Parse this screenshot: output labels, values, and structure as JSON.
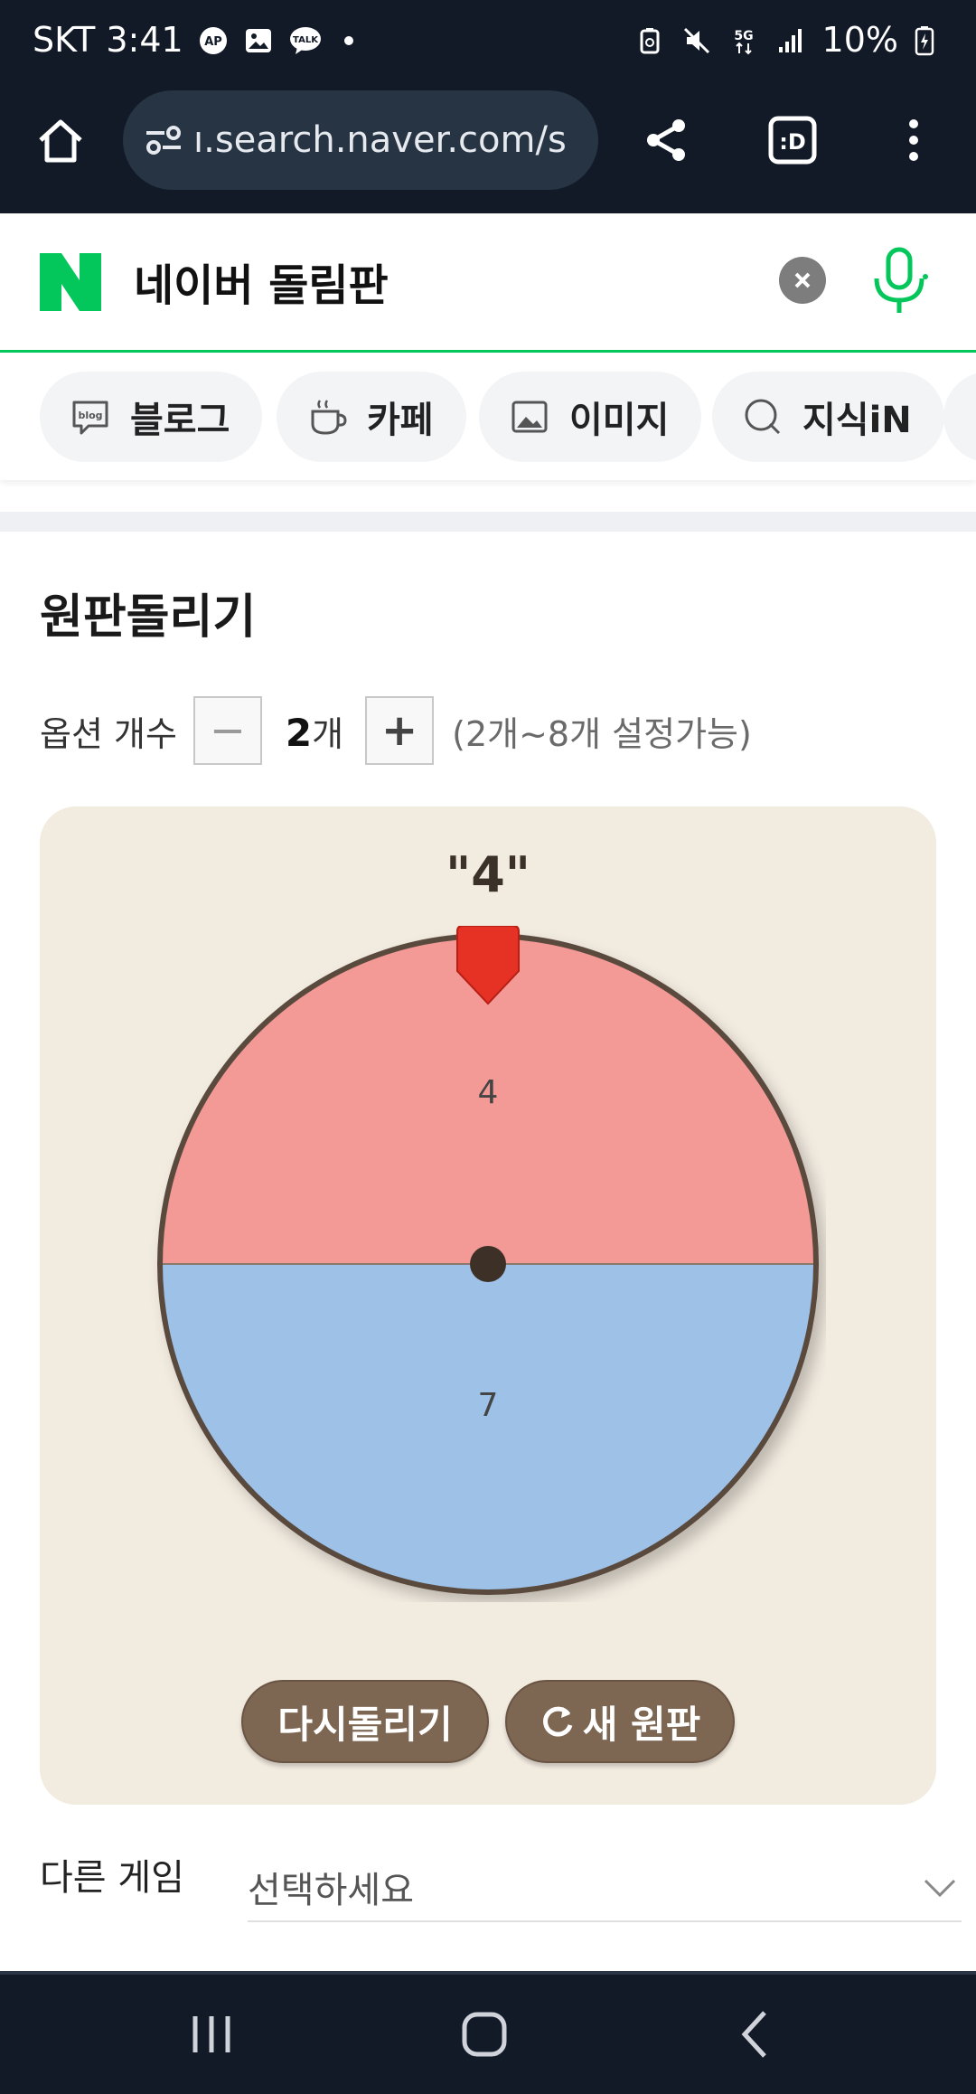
{
  "status_bar": {
    "carrier_time": "SKT 3:41",
    "battery": "10%",
    "network": "5G",
    "notification_icons": [
      "ap-icon",
      "gallery-icon",
      "talk-icon",
      "dot-icon"
    ],
    "system_icons": [
      "recycle-icon",
      "mute-icon",
      "5g-icon",
      "signal-icon",
      "battery-icon"
    ]
  },
  "browser": {
    "url": "ı.search.naver.com/s"
  },
  "search": {
    "query": "네이버 돌림판"
  },
  "tabs": [
    {
      "label": "블로그",
      "icon": "blog-icon"
    },
    {
      "label": "카페",
      "icon": "cafe-icon"
    },
    {
      "label": "이미지",
      "icon": "image-icon"
    },
    {
      "label": "지식iN",
      "icon": "kin-icon"
    }
  ],
  "widget": {
    "title": "원판돌리기",
    "option_label": "옵션 개수",
    "count_value": "2",
    "count_unit": "개",
    "count_hint": "(2개~8개 설정가능)",
    "minus_symbol": "−",
    "plus_symbol": "+",
    "result": "\"4\"",
    "segments": [
      {
        "label": "4",
        "color": "#f39a96"
      },
      {
        "label": "7",
        "color": "#9ec1e8"
      }
    ],
    "spin_again_label": "다시돌리기",
    "new_wheel_label": "새 원판"
  },
  "other_game": {
    "label": "다른 게임",
    "select_value": "선택하세요"
  },
  "colors": {
    "brand_green": "#03c75a",
    "wheel_rim": "#5a4a3d",
    "button_brown": "#7d6652",
    "card_bg": "#f2ebe0",
    "pointer_red": "#e53224"
  }
}
